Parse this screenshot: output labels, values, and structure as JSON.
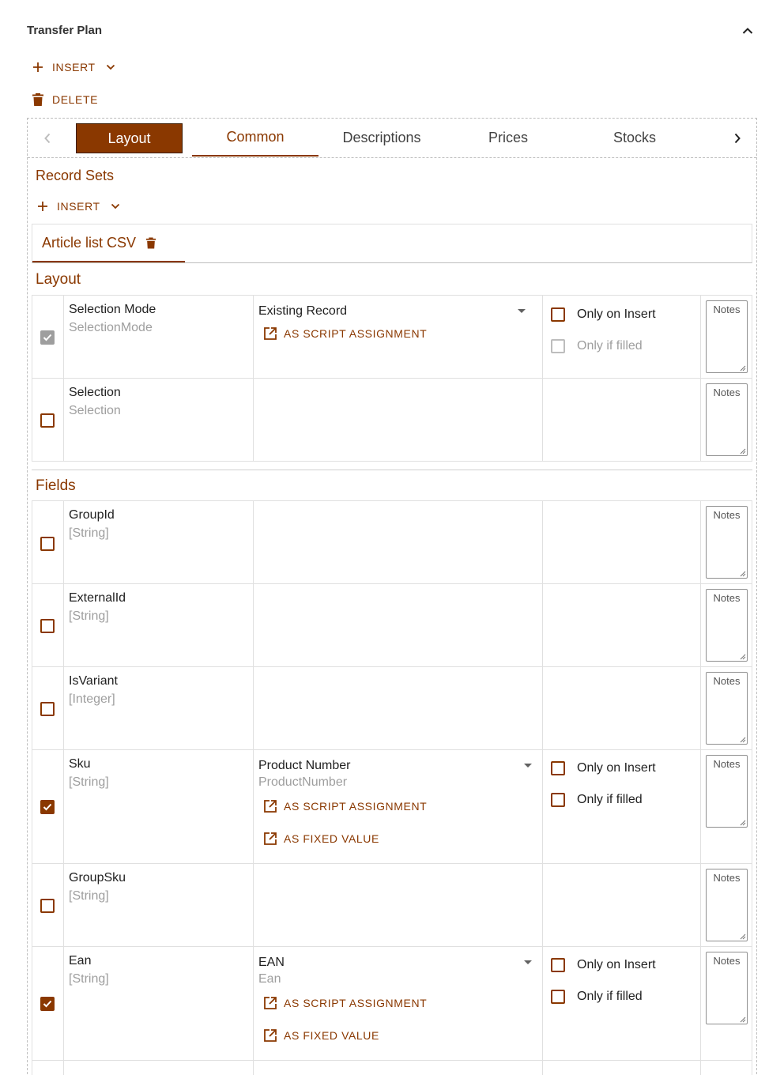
{
  "header": {
    "title": "Transfer Plan",
    "insert_label": "INSERT",
    "delete_label": "DELETE"
  },
  "tabs": [
    {
      "label": "Layout"
    },
    {
      "label": "Common"
    },
    {
      "label": "Descriptions"
    },
    {
      "label": "Prices"
    },
    {
      "label": "Stocks"
    }
  ],
  "record_sets": {
    "title": "Record Sets",
    "insert_label": "INSERT",
    "active_tab": "Article list CSV"
  },
  "layout_section": {
    "title": "Layout",
    "rows": [
      {
        "name": "Selection Mode",
        "sub": "SelectionMode",
        "value": "Existing Record",
        "script_label": "AS SCRIPT ASSIGNMENT",
        "only_on_insert": "Only on Insert",
        "only_if_filled": "Only if filled",
        "notes": "Notes"
      },
      {
        "name": "Selection",
        "sub": "Selection",
        "notes": "Notes"
      }
    ]
  },
  "fields_section": {
    "title": "Fields",
    "rows": [
      {
        "name": "GroupId",
        "type": "[String]",
        "notes": "Notes"
      },
      {
        "name": "ExternalId",
        "type": "[String]",
        "notes": "Notes"
      },
      {
        "name": "IsVariant",
        "type": "[Integer]",
        "notes": "Notes"
      },
      {
        "name": "Sku",
        "type": "[String]",
        "value": "Product Number",
        "value_sub": "ProductNumber",
        "script_label": "AS SCRIPT ASSIGNMENT",
        "fixed_label": "AS FIXED VALUE",
        "only_on_insert": "Only on Insert",
        "only_if_filled": "Only if filled",
        "notes": "Notes"
      },
      {
        "name": "GroupSku",
        "type": "[String]",
        "notes": "Notes"
      },
      {
        "name": "Ean",
        "type": "[String]",
        "value": "EAN",
        "value_sub": "Ean",
        "script_label": "AS SCRIPT ASSIGNMENT",
        "fixed_label": "AS FIXED VALUE",
        "only_on_insert": "Only on Insert",
        "only_if_filled": "Only if filled",
        "notes": "Notes"
      }
    ]
  },
  "colors": {
    "accent": "#8a3800",
    "muted": "#9e9e9e",
    "border": "#e0e0e0"
  }
}
